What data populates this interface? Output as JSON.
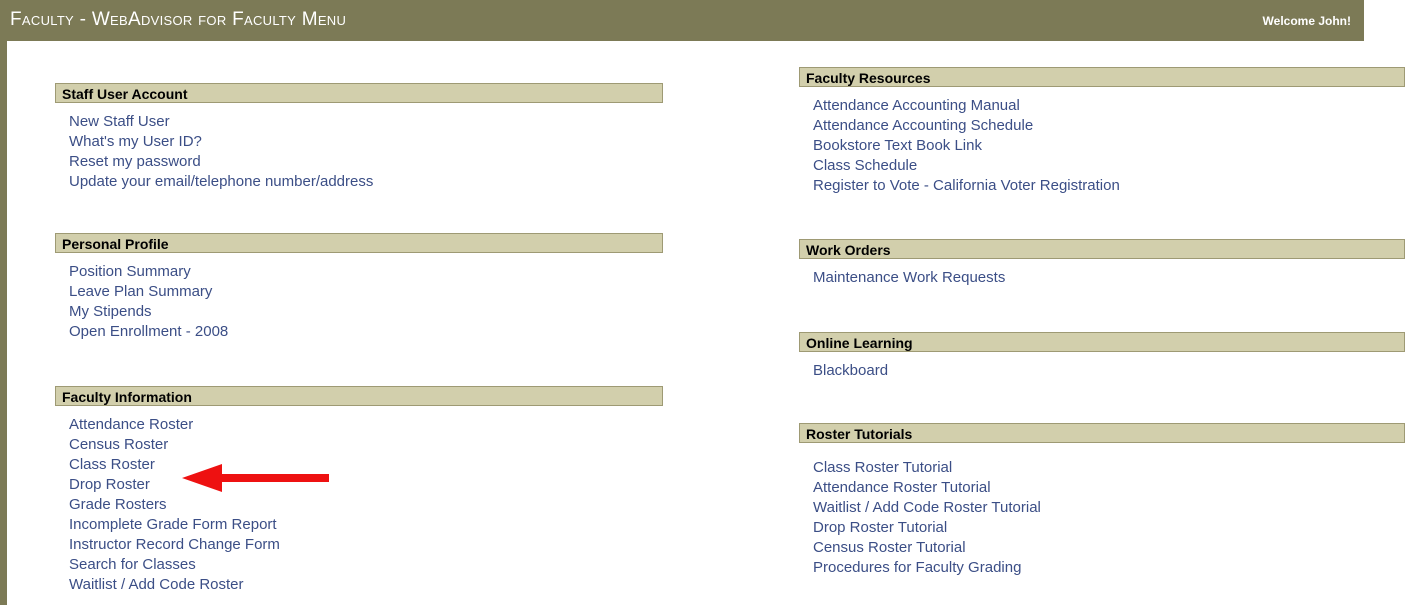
{
  "header": {
    "title": "Faculty - WebAdvisor for Faculty Menu",
    "welcome": "Welcome John!"
  },
  "left_sections": [
    {
      "title": "Staff User Account",
      "links": [
        "New Staff User",
        "What's my User ID?",
        "Reset my password",
        "Update your email/telephone number/address"
      ]
    },
    {
      "title": "Personal Profile",
      "links": [
        "Position Summary",
        "Leave Plan Summary",
        "My Stipends",
        "Open Enrollment - 2008"
      ]
    },
    {
      "title": "Faculty Information",
      "links": [
        "Attendance Roster",
        "Census Roster",
        "Class Roster",
        "Drop Roster",
        "Grade Rosters",
        "Incomplete Grade Form Report",
        "Instructor Record Change Form",
        "Search for Classes",
        "Waitlist / Add Code Roster"
      ]
    }
  ],
  "right_sections": [
    {
      "title": "Faculty Resources",
      "links": [
        "Attendance Accounting Manual",
        "Attendance Accounting Schedule",
        "Bookstore Text Book Link",
        "Class Schedule",
        "Register to Vote - California Voter Registration"
      ]
    },
    {
      "title": "Work Orders",
      "links": [
        "Maintenance Work Requests"
      ]
    },
    {
      "title": "Online Learning",
      "links": [
        "Blackboard"
      ]
    },
    {
      "title": "Roster Tutorials",
      "links": [
        "Class Roster Tutorial",
        "Attendance Roster Tutorial",
        "Waitlist / Add Code Roster Tutorial",
        "Drop Roster Tutorial",
        "Census Roster Tutorial",
        "Procedures for Faculty Grading"
      ]
    }
  ],
  "colors": {
    "header_bg": "#7c7a56",
    "section_bg": "#d2cfac",
    "link": "#3b4e86",
    "arrow": "#ee1111"
  }
}
